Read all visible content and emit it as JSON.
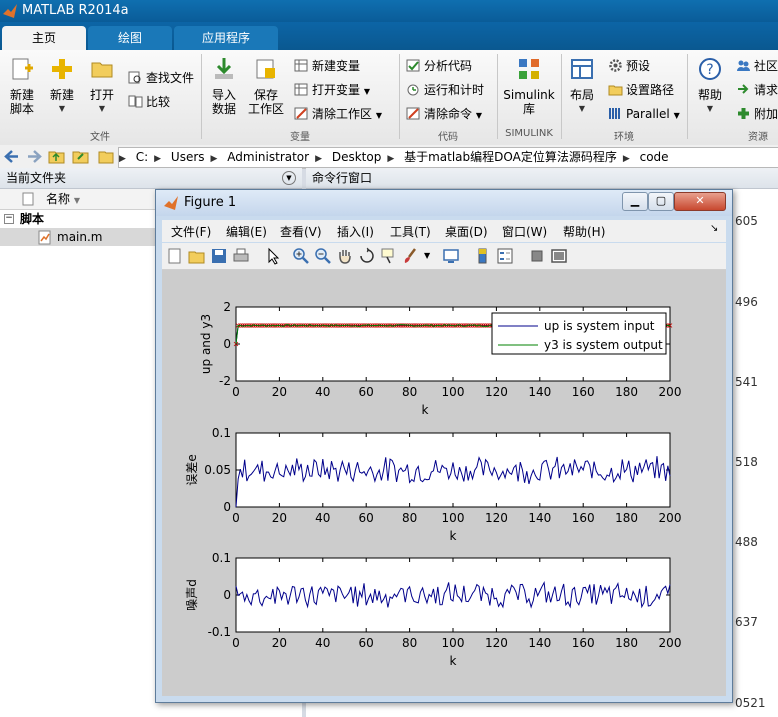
{
  "app": {
    "title": "MATLAB R2014a"
  },
  "tabs": [
    "主页",
    "绘图",
    "应用程序"
  ],
  "ribbon": {
    "new_script": [
      "新建",
      "脚本"
    ],
    "new": "新建",
    "open": "打开",
    "find_files": "查找文件",
    "compare": "比较",
    "import": [
      "导入",
      "数据"
    ],
    "save_ws": [
      "保存",
      "工作区"
    ],
    "new_var": "新建变量",
    "open_var": "打开变量",
    "clear_ws": "清除工作区",
    "analyze": "分析代码",
    "run_time": "运行和计时",
    "clear_cmd": "清除命令",
    "simulink": [
      "Simulink",
      "库"
    ],
    "layout": "布局",
    "prefs": "预设",
    "set_path": "设置路径",
    "parallel": "Parallel",
    "help": "帮助",
    "community": "社区",
    "request": "请求",
    "addons": "附加",
    "groups": [
      "文件",
      "变量",
      "代码",
      "SIMULINK",
      "环境",
      "资源"
    ]
  },
  "address": {
    "path": [
      "C:",
      "Users",
      "Administrator",
      "Desktop",
      "基于matlab编程DOA定位算法源码程序",
      "code"
    ]
  },
  "left_panel": {
    "title": "当前文件夹",
    "col_name": "名称",
    "group": "脚本",
    "file": "main.m"
  },
  "right_panel": {
    "title": "命令行窗口",
    "side_numbers": [
      "605",
      "496",
      "541",
      "518",
      "488",
      "637",
      "0521"
    ]
  },
  "figure": {
    "title": "Figure 1",
    "menus": [
      "文件(F)",
      "编辑(E)",
      "查看(V)",
      "插入(I)",
      "工具(T)",
      "桌面(D)",
      "窗口(W)",
      "帮助(H)"
    ]
  },
  "chart_data": [
    {
      "type": "line",
      "xlabel": "k",
      "ylabel": "up  and  y3",
      "xlim": [
        0,
        200
      ],
      "ylim": [
        -2,
        2
      ],
      "xticks": [
        0,
        20,
        40,
        60,
        80,
        100,
        120,
        140,
        160,
        180,
        200
      ],
      "yticks": [
        -2,
        0,
        2
      ],
      "legend_position": "top-right",
      "series": [
        {
          "name": "up is system input",
          "color": "#00008b",
          "marker": "x",
          "marker_color": "#cc0000",
          "values_desc": "step to 1 at k=1, constant 1 thereafter",
          "start": 0,
          "level": 1
        },
        {
          "name": "y3 is system output",
          "color": "#008000",
          "start": 0,
          "level": 1,
          "noise": 0.05
        }
      ]
    },
    {
      "type": "line",
      "xlabel": "k",
      "ylabel": "误差e",
      "xlim": [
        0,
        200
      ],
      "ylim": [
        0,
        0.1
      ],
      "xticks": [
        0,
        20,
        40,
        60,
        80,
        100,
        120,
        140,
        160,
        180,
        200
      ],
      "yticks": [
        0,
        0.05,
        0.1
      ],
      "series": [
        {
          "color": "#00008b",
          "mean": 0.05,
          "amplitude": 0.015
        }
      ]
    },
    {
      "type": "line",
      "xlabel": "k",
      "ylabel": "噪声d",
      "xlim": [
        0,
        200
      ],
      "ylim": [
        -0.1,
        0.1
      ],
      "xticks": [
        0,
        20,
        40,
        60,
        80,
        100,
        120,
        140,
        160,
        180,
        200
      ],
      "yticks": [
        -0.1,
        0,
        0.1
      ],
      "series": [
        {
          "color": "#00008b",
          "mean": 0,
          "amplitude": 0.03
        }
      ]
    }
  ]
}
